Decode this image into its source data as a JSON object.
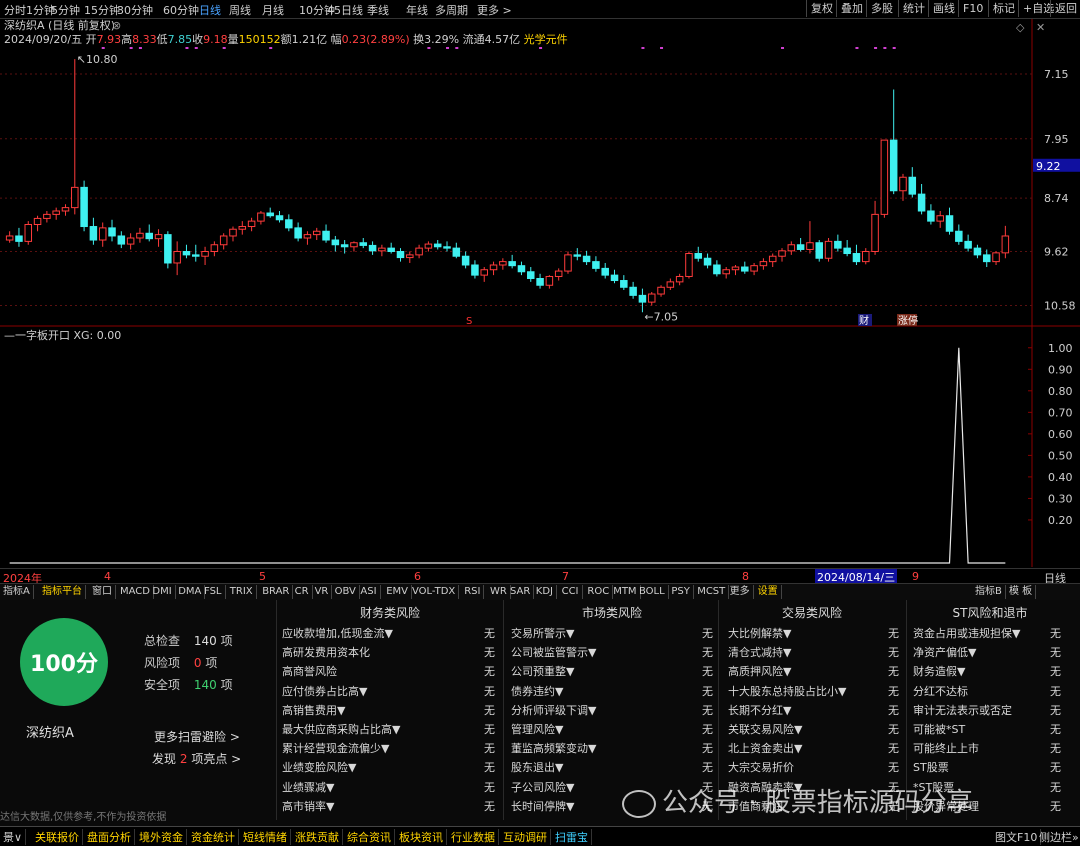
{
  "colors": {
    "up": "#ff3b3b",
    "down": "#3ff0f0",
    "yellow": "#ffd400",
    "score_bg": "#1fa95a",
    "purple": "#d040d0",
    "accent": "#4aa3ff"
  },
  "topbar": {
    "left_items": [
      "分时",
      "1分钟",
      "5分钟",
      "15分钟",
      "30分钟",
      "60分钟",
      "日线",
      "周线",
      "月线",
      "10分钟",
      "45日线",
      "季线",
      "年线",
      "多周期",
      "更多 >"
    ],
    "active": "日线",
    "right_items": [
      "复权",
      "叠加",
      "多股",
      "统计",
      "画线",
      "F10",
      "标记",
      "+自选",
      "返回"
    ]
  },
  "stock": {
    "title": "深纺织A (日线 前复权)",
    "date": "2024/09/20/五",
    "open_label": "开",
    "open": "7.93",
    "high_label": "高",
    "high": "8.33",
    "low_label": "低",
    "low": "7.85",
    "close_label": "收",
    "close": "9.18",
    "vol_label": "量",
    "vol": "150152",
    "amt_label": "额",
    "amt": "1.21亿",
    "chg_label": "幅",
    "chg": "0.23(2.89%)",
    "turn": "换3.29%",
    "float": "流通4.57亿",
    "concept": "光学元件"
  },
  "price_axis": [
    "10.58",
    "9.62",
    "8.74",
    "7.95",
    "7.15"
  ],
  "current_price": "9.22",
  "annotations": {
    "high": "10.80",
    "low": "7.05",
    "mark_s": "S",
    "mark_cai": "财",
    "mark_zhang": "涨停"
  },
  "indicator": {
    "name": "一字板开口",
    "xg": "XG: 0.00",
    "axis": [
      "1.00",
      "0.90",
      "0.80",
      "0.70",
      "0.60",
      "0.50",
      "0.40",
      "0.30",
      "0.20"
    ]
  },
  "datebar": {
    "labels": [
      "2024年",
      "4",
      "5",
      "6",
      "7",
      "8",
      "9"
    ],
    "selected": "2024/08/14/三",
    "period": "日线"
  },
  "tabs": [
    "指标A",
    "指标平台",
    "窗口",
    "MACD",
    "DMI",
    "DMA",
    "FSL",
    "TRIX",
    "BRAR",
    "CR",
    "VR",
    "OBV",
    "ASI",
    "EMV",
    "VOL-TDX",
    "RSI",
    "WR",
    "SAR",
    "KDJ",
    "CCI",
    "ROC",
    "MTM",
    "BOLL",
    "PSY",
    "MCST",
    "更多",
    "设置"
  ],
  "tabs_right": [
    "指标B",
    "模 板"
  ],
  "score": {
    "value": "100分",
    "name": "深纺织A",
    "total_label": "总检查",
    "total": "140",
    "total_unit": "项",
    "risk_label": "风险项",
    "risk": "0",
    "risk_unit": "项",
    "safe_label": "安全项",
    "safe": "140",
    "safe_unit": "项",
    "more": "更多扫雷避险 >",
    "found_pre": "发现",
    "found": "2",
    "found_post": "项亮点 >",
    "disclaimer": "达信大数据,仅供参考,不作为投资依据"
  },
  "sections": [
    {
      "title": "财务类风险",
      "rows": [
        {
          "label": "应收款增加,低现金流▼",
          "val": "无"
        },
        {
          "label": "高研发费用资本化",
          "val": "无"
        },
        {
          "label": "高商誉风险",
          "val": "无"
        },
        {
          "label": "应付债券占比高▼",
          "val": "无"
        },
        {
          "label": "高销售费用▼",
          "val": "无"
        },
        {
          "label": "最大供应商采购占比高▼",
          "val": "无"
        },
        {
          "label": "累计经营现金流偏少▼",
          "val": "无"
        },
        {
          "label": "业绩变脸风险▼",
          "val": "无"
        },
        {
          "label": "业绩骤减▼",
          "val": "无"
        },
        {
          "label": "高市销率▼",
          "val": "无"
        }
      ]
    },
    {
      "title": "市场类风险",
      "rows": [
        {
          "label": "交易所警示▼",
          "val": "无"
        },
        {
          "label": "公司被监管警示▼",
          "val": "无"
        },
        {
          "label": "公司预重整▼",
          "val": "无"
        },
        {
          "label": "债券违约▼",
          "val": "无"
        },
        {
          "label": "分析师评级下调▼",
          "val": "无"
        },
        {
          "label": "管理风险▼",
          "val": "无"
        },
        {
          "label": "董监高频繁变动▼",
          "val": "无"
        },
        {
          "label": "股东退出▼",
          "val": "无"
        },
        {
          "label": "子公司风险▼",
          "val": "无"
        },
        {
          "label": "长时间停牌▼",
          "val": "无"
        }
      ]
    },
    {
      "title": "交易类风险",
      "rows": [
        {
          "label": "大比例解禁▼",
          "val": "无"
        },
        {
          "label": "清仓式减持▼",
          "val": "无"
        },
        {
          "label": "高质押风险▼",
          "val": "无"
        },
        {
          "label": "十大股东总持股占比小▼",
          "val": "无"
        },
        {
          "label": "长期不分红▼",
          "val": "无"
        },
        {
          "label": "关联交易风险▼",
          "val": "无"
        },
        {
          "label": "北上资金卖出▼",
          "val": "无"
        },
        {
          "label": "大宗交易折价",
          "val": "无"
        },
        {
          "label": "融资高融卖率▼",
          "val": "无"
        },
        {
          "label": "市值商剩润",
          "val": "无"
        }
      ]
    },
    {
      "title": "ST风险和退市",
      "rows": [
        {
          "label": "资金占用或违规担保▼",
          "val": "无"
        },
        {
          "label": "净资产偏低▼",
          "val": "无"
        },
        {
          "label": "财务造假▼",
          "val": "无"
        },
        {
          "label": "分红不达标",
          "val": "无"
        },
        {
          "label": "审计无法表示或否定",
          "val": "无"
        },
        {
          "label": "可能被*ST",
          "val": "无"
        },
        {
          "label": "可能终止上市",
          "val": "无"
        },
        {
          "label": "ST股票",
          "val": "无"
        },
        {
          "label": "*ST股票",
          "val": "无"
        },
        {
          "label": "股价异常处理",
          "val": "无"
        }
      ]
    }
  ],
  "watermark": "公众号 · 股票指标源码分享",
  "bottombar": {
    "items": [
      "景∨",
      "关联报价",
      "盘面分析",
      "境外资金",
      "资金统计",
      "短线情绪",
      "涨跌贡献",
      "综合资讯",
      "板块资讯",
      "行业数据",
      "互动调研",
      "扫雷宝"
    ],
    "right": [
      "图文F10",
      "侧边栏»"
    ]
  },
  "chart_data": {
    "type": "candlestick",
    "price_axis": [
      7.15,
      7.95,
      8.74,
      9.62,
      10.58
    ],
    "ylim": [
      6.95,
      10.95
    ],
    "ohlc": [
      [
        8.12,
        8.25,
        8.08,
        8.18
      ],
      [
        8.18,
        8.3,
        8.02,
        8.1
      ],
      [
        8.1,
        8.4,
        8.05,
        8.35
      ],
      [
        8.35,
        8.48,
        8.25,
        8.44
      ],
      [
        8.44,
        8.55,
        8.38,
        8.5
      ],
      [
        8.5,
        8.6,
        8.42,
        8.55
      ],
      [
        8.55,
        8.65,
        8.48,
        8.6
      ],
      [
        8.6,
        10.8,
        8.5,
        8.9
      ],
      [
        8.9,
        9.0,
        8.25,
        8.32
      ],
      [
        8.32,
        8.45,
        8.05,
        8.12
      ],
      [
        8.12,
        8.38,
        8.02,
        8.3
      ],
      [
        8.3,
        8.42,
        8.1,
        8.18
      ],
      [
        8.18,
        8.25,
        8.0,
        8.06
      ],
      [
        8.06,
        8.22,
        7.98,
        8.15
      ],
      [
        8.15,
        8.3,
        8.08,
        8.22
      ],
      [
        8.22,
        8.35,
        8.1,
        8.14
      ],
      [
        8.14,
        8.28,
        8.02,
        8.2
      ],
      [
        8.2,
        8.25,
        7.7,
        7.78
      ],
      [
        7.78,
        8.1,
        7.6,
        7.95
      ],
      [
        7.95,
        8.05,
        7.85,
        7.9
      ],
      [
        7.9,
        8.05,
        7.8,
        7.88
      ],
      [
        7.88,
        8.02,
        7.75,
        7.95
      ],
      [
        7.95,
        8.1,
        7.88,
        8.05
      ],
      [
        8.05,
        8.22,
        7.98,
        8.18
      ],
      [
        8.18,
        8.32,
        8.1,
        8.28
      ],
      [
        8.28,
        8.4,
        8.2,
        8.32
      ],
      [
        8.32,
        8.45,
        8.25,
        8.4
      ],
      [
        8.4,
        8.55,
        8.35,
        8.52
      ],
      [
        8.52,
        8.6,
        8.45,
        8.48
      ],
      [
        8.48,
        8.55,
        8.38,
        8.42
      ],
      [
        8.42,
        8.5,
        8.25,
        8.3
      ],
      [
        8.3,
        8.38,
        8.1,
        8.15
      ],
      [
        8.15,
        8.25,
        8.05,
        8.2
      ],
      [
        8.2,
        8.3,
        8.12,
        8.25
      ],
      [
        8.25,
        8.35,
        8.08,
        8.12
      ],
      [
        8.12,
        8.18,
        7.95,
        8.05
      ],
      [
        8.05,
        8.12,
        7.92,
        8.02
      ],
      [
        8.02,
        8.1,
        7.95,
        8.08
      ],
      [
        8.08,
        8.15,
        8.0,
        8.04
      ],
      [
        8.04,
        8.1,
        7.9,
        7.96
      ],
      [
        7.96,
        8.05,
        7.88,
        8.0
      ],
      [
        8.0,
        8.08,
        7.92,
        7.95
      ],
      [
        7.95,
        8.0,
        7.8,
        7.86
      ],
      [
        7.86,
        7.95,
        7.78,
        7.9
      ],
      [
        7.9,
        8.05,
        7.85,
        8.0
      ],
      [
        8.0,
        8.1,
        7.95,
        8.06
      ],
      [
        8.06,
        8.12,
        7.98,
        8.02
      ],
      [
        8.02,
        8.1,
        7.95,
        8.0
      ],
      [
        8.0,
        8.08,
        7.85,
        7.88
      ],
      [
        7.88,
        7.95,
        7.7,
        7.75
      ],
      [
        7.75,
        7.82,
        7.55,
        7.6
      ],
      [
        7.6,
        7.72,
        7.5,
        7.68
      ],
      [
        7.68,
        7.8,
        7.6,
        7.75
      ],
      [
        7.75,
        7.85,
        7.68,
        7.8
      ],
      [
        7.8,
        7.9,
        7.7,
        7.74
      ],
      [
        7.74,
        7.8,
        7.6,
        7.65
      ],
      [
        7.65,
        7.72,
        7.5,
        7.55
      ],
      [
        7.55,
        7.62,
        7.4,
        7.45
      ],
      [
        7.45,
        7.6,
        7.4,
        7.58
      ],
      [
        7.58,
        7.7,
        7.52,
        7.66
      ],
      [
        7.66,
        7.95,
        7.62,
        7.9
      ],
      [
        7.9,
        8.0,
        7.82,
        7.88
      ],
      [
        7.88,
        7.96,
        7.75,
        7.8
      ],
      [
        7.8,
        7.88,
        7.65,
        7.7
      ],
      [
        7.7,
        7.78,
        7.55,
        7.6
      ],
      [
        7.6,
        7.68,
        7.48,
        7.52
      ],
      [
        7.52,
        7.6,
        7.38,
        7.42
      ],
      [
        7.42,
        7.5,
        7.25,
        7.3
      ],
      [
        7.3,
        7.4,
        7.05,
        7.2
      ],
      [
        7.2,
        7.35,
        7.15,
        7.32
      ],
      [
        7.32,
        7.45,
        7.28,
        7.42
      ],
      [
        7.42,
        7.55,
        7.38,
        7.5
      ],
      [
        7.5,
        7.62,
        7.45,
        7.58
      ],
      [
        7.58,
        7.95,
        7.55,
        7.92
      ],
      [
        7.92,
        8.02,
        7.8,
        7.85
      ],
      [
        7.85,
        7.92,
        7.7,
        7.75
      ],
      [
        7.75,
        7.82,
        7.58,
        7.62
      ],
      [
        7.62,
        7.72,
        7.55,
        7.68
      ],
      [
        7.68,
        7.75,
        7.6,
        7.72
      ],
      [
        7.72,
        7.8,
        7.62,
        7.66
      ],
      [
        7.66,
        7.78,
        7.6,
        7.74
      ],
      [
        7.74,
        7.85,
        7.68,
        7.8
      ],
      [
        7.8,
        7.92,
        7.72,
        7.88
      ],
      [
        7.88,
        8.0,
        7.8,
        7.96
      ],
      [
        7.96,
        8.1,
        7.9,
        8.05
      ],
      [
        8.05,
        8.15,
        7.95,
        7.98
      ],
      [
        7.98,
        8.4,
        7.92,
        8.08
      ],
      [
        8.08,
        8.12,
        7.8,
        7.85
      ],
      [
        7.85,
        8.15,
        7.8,
        8.1
      ],
      [
        8.1,
        8.2,
        7.95,
        8.0
      ],
      [
        8.0,
        8.12,
        7.88,
        7.92
      ],
      [
        7.92,
        8.05,
        7.75,
        7.8
      ],
      [
        7.8,
        8.0,
        7.76,
        7.95
      ],
      [
        7.95,
        8.7,
        7.9,
        8.5
      ],
      [
        8.5,
        9.6,
        8.45,
        9.6
      ],
      [
        9.6,
        10.35,
        8.8,
        8.85
      ],
      [
        8.85,
        9.1,
        8.7,
        9.05
      ],
      [
        9.05,
        9.2,
        8.75,
        8.8
      ],
      [
        8.8,
        8.95,
        8.5,
        8.55
      ],
      [
        8.55,
        8.65,
        8.35,
        8.4
      ],
      [
        8.4,
        8.55,
        8.3,
        8.48
      ],
      [
        8.48,
        8.6,
        8.2,
        8.25
      ],
      [
        8.25,
        8.35,
        8.05,
        8.1
      ],
      [
        8.1,
        8.2,
        7.95,
        8.0
      ],
      [
        8.0,
        8.05,
        7.85,
        7.9
      ],
      [
        7.9,
        7.98,
        7.72,
        7.8
      ],
      [
        7.8,
        7.95,
        7.75,
        7.93
      ],
      [
        7.93,
        8.33,
        7.85,
        8.18
      ]
    ],
    "indicator_series": {
      "name": "一字板开口",
      "peak_index": 102,
      "peak_value": 1.0,
      "ylim": [
        0,
        1.05
      ]
    }
  }
}
